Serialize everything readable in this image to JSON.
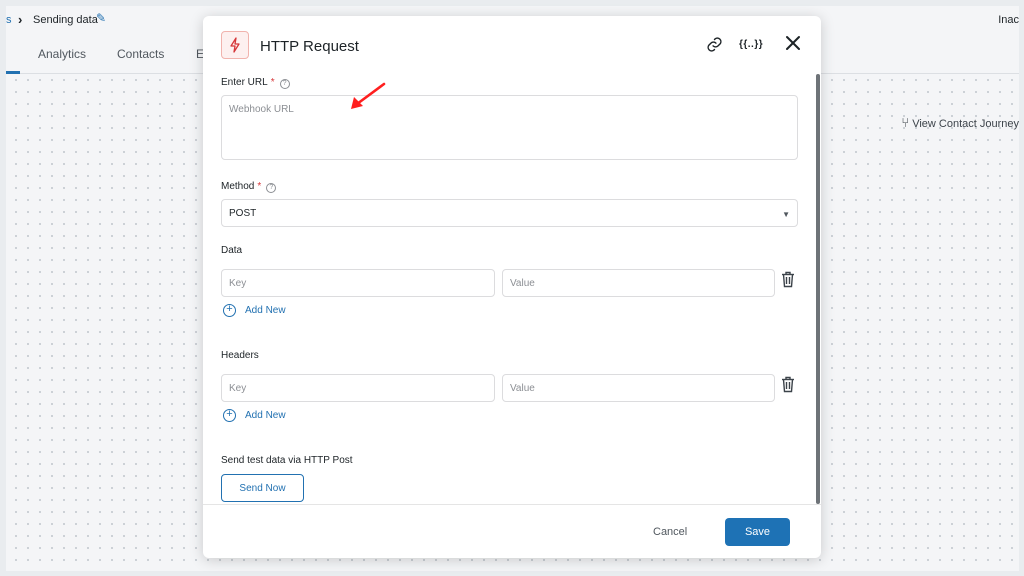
{
  "breadcrumb": {
    "prev_fragment": "s",
    "title": "Sending data"
  },
  "status_fragment": "Inac",
  "tabs": [
    {
      "label": "Analytics"
    },
    {
      "label": "Contacts"
    },
    {
      "label": "E"
    }
  ],
  "journey_link": {
    "label": "View Contact Journey"
  },
  "modal": {
    "title": "HTTP Request",
    "header_icons": [
      "link-icon",
      "merge-tags-icon",
      "close-icon"
    ],
    "merge_tag_label": "{{..}}",
    "url": {
      "label": "Enter URL",
      "required": "*",
      "placeholder": "Webhook URL",
      "value": ""
    },
    "method": {
      "label": "Method",
      "required": "*",
      "value": "POST"
    },
    "data_section": {
      "label": "Data",
      "key_placeholder": "Key",
      "value_placeholder": "Value",
      "add_label": "Add New"
    },
    "headers_section": {
      "label": "Headers",
      "key_placeholder": "Key",
      "value_placeholder": "Value",
      "add_label": "Add New"
    },
    "test": {
      "label": "Send test data via HTTP Post",
      "button": "Send Now"
    },
    "footer": {
      "cancel": "Cancel",
      "save": "Save"
    }
  },
  "colors": {
    "accent": "#2271b1",
    "save": "#1e72b5",
    "required": "#d63638",
    "annotation_arrow": "#ff1f1f"
  }
}
